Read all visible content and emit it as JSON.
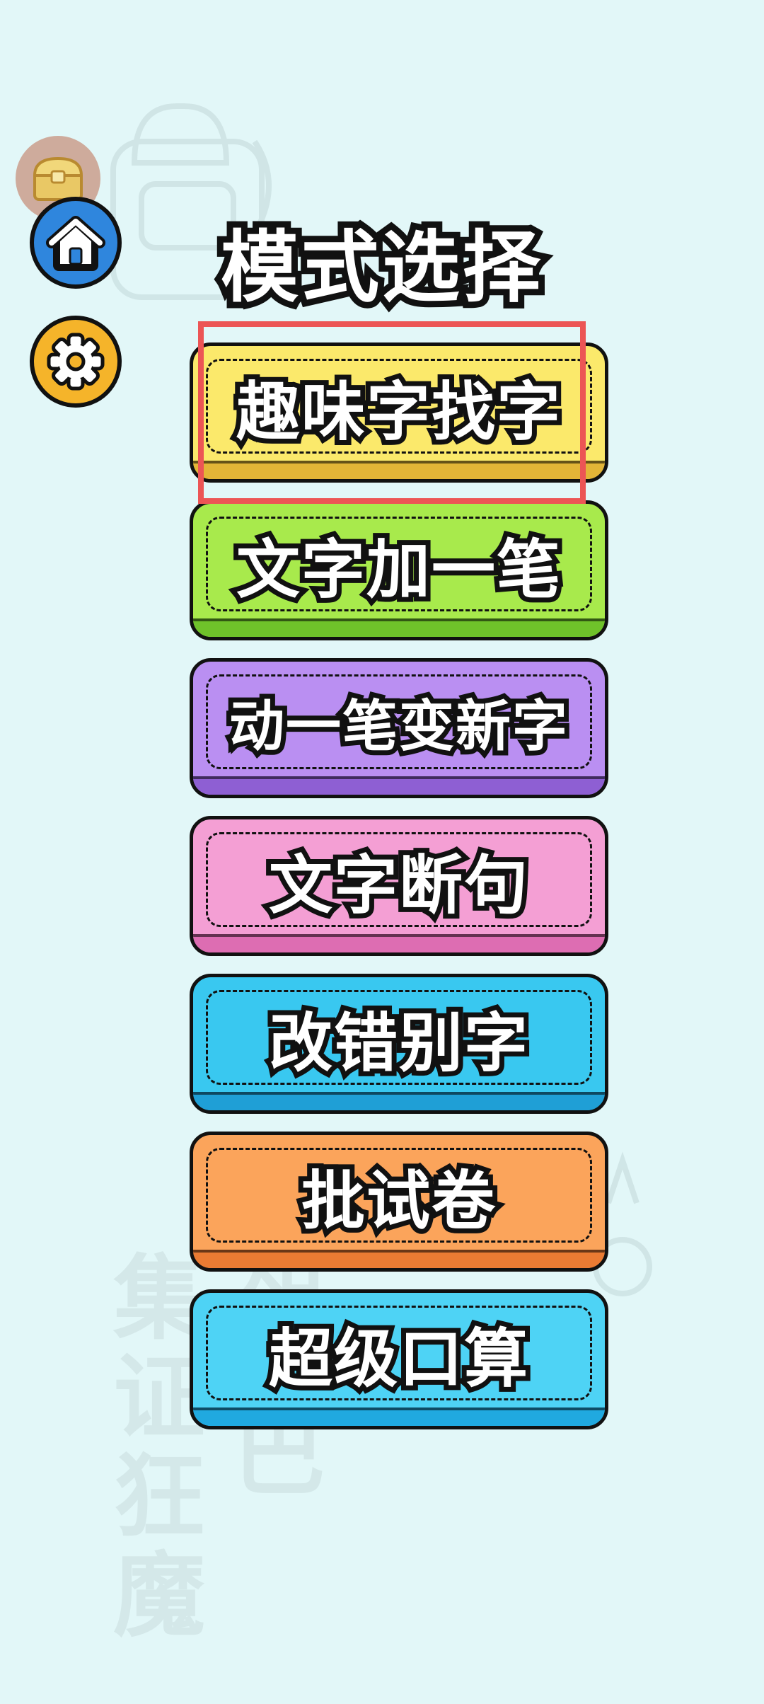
{
  "title": "模式选择",
  "nav": {
    "home_icon": "home-icon",
    "settings_icon": "gear-icon",
    "chest_icon": "treasure-chest-icon"
  },
  "modes": [
    {
      "label": "趣味字找字",
      "color": "#fbe96b",
      "shade": "#e3b537"
    },
    {
      "label": "文字加一笔",
      "color": "#a8ea4c",
      "shade": "#6fc22a"
    },
    {
      "label": "动一笔变新字",
      "color": "#ba8ff2",
      "shade": "#8e5fd3"
    },
    {
      "label": "文字断句",
      "color": "#f49fd4",
      "shade": "#dd6db2"
    },
    {
      "label": "改错别字",
      "color": "#39c8f0",
      "shade": "#1f9fd6"
    },
    {
      "label": "批试卷",
      "color": "#fba45b",
      "shade": "#ea7b33"
    },
    {
      "label": "超级口算",
      "color": "#4ed3f5",
      "shade": "#20a9e0"
    }
  ],
  "watermark": {
    "left": "集证狂魔",
    "right": "知巴"
  },
  "colors": {
    "background": "#e2f7f8",
    "highlight": "#ec5555",
    "home_button": "#2f86dd",
    "settings_button": "#f5b42a"
  }
}
